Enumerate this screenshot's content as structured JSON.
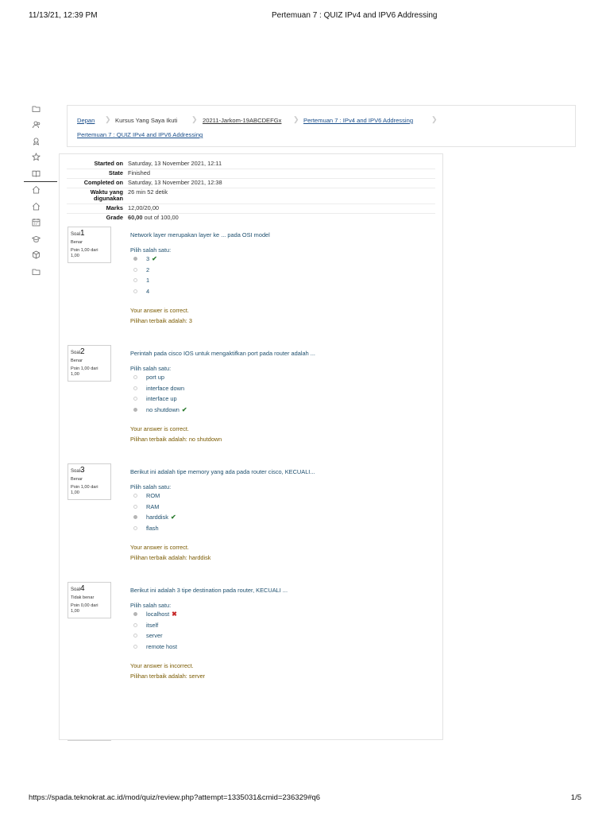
{
  "print": {
    "datetime": "11/13/21, 12:39 PM",
    "title": "Pertemuan 7 : QUIZ IPv4 and IPV6 Addressing",
    "url": "https://spada.teknokrat.ac.id/mod/quiz/review.php?attempt=1335031&cmid=236329#q6",
    "page": "1/5"
  },
  "rail_icons": [
    "folder-icon",
    "users-icon",
    "badge-icon",
    "star-icon",
    "book-icon",
    "home-icon",
    "home-icon",
    "calendar-icon",
    "graduation-cap-icon",
    "cube-icon",
    "folder-icon"
  ],
  "breadcrumb": [
    {
      "label": "Depan"
    },
    {
      "label": "Kursus Yang Saya Ikuti"
    },
    {
      "label": "20211-Jarkom-19ABCDEFGx"
    },
    {
      "label": "Pertemuan 7 : IPv4 and IPV6 Addressing"
    },
    {
      "label": "Pertemuan 7 : QUIZ IPv4 and IPV6 Addressing"
    }
  ],
  "summary": {
    "started_label": "Started on",
    "started_value": "Saturday, 13 November 2021, 12:11",
    "state_label": "State",
    "state_value": "Finished",
    "completed_label": "Completed on",
    "completed_value": "Saturday, 13 November 2021, 12:38",
    "time_label_1": "Waktu yang",
    "time_label_2": "digunakan",
    "time_value": "26 min 52 detik",
    "marks_label": "Marks",
    "marks_value": "12,00/20,00",
    "grade_label": "Grade",
    "grade_value_bold": "60,00",
    "grade_value_rest": " out of 100,00"
  },
  "questions": [
    {
      "soal": "Soal",
      "number": "1",
      "status": "Benar",
      "mark_line1": "Poin 1,00 dari",
      "mark_line2": "1,00",
      "text": "Network layer merupakan layer ke ... pada OSI model",
      "prompt": "Pilih salah satu:",
      "options": [
        "3",
        "2",
        "1",
        "4"
      ],
      "selected": 0,
      "result": "correct",
      "feedback": "Your answer is correct.",
      "right_answer": "Pilihan terbaik adalah: 3"
    },
    {
      "soal": "Soal",
      "number": "2",
      "status": "Benar",
      "mark_line1": "Poin 1,00 dari",
      "mark_line2": "1,00",
      "text": "Perintah pada cisco IOS untuk mengaktifkan port pada router adalah ...",
      "prompt": "Pilih salah satu:",
      "options": [
        "port up",
        "interface down",
        "interface up",
        "no shutdown"
      ],
      "selected": 3,
      "result": "correct",
      "feedback": "Your answer is correct.",
      "right_answer": "Pilihan terbaik adalah: no shutdown"
    },
    {
      "soal": "Soal",
      "number": "3",
      "status": "Benar",
      "mark_line1": "Poin 1,00 dari",
      "mark_line2": "1,00",
      "text": "Berikut ini adalah tipe memory yang ada pada router cisco, KECUALI...",
      "prompt": "Pilih salah satu:",
      "options": [
        "ROM",
        "RAM",
        "harddisk",
        "flash"
      ],
      "selected": 2,
      "result": "correct",
      "feedback": "Your answer is correct.",
      "right_answer": "Pilihan terbaik adalah: harddisk"
    },
    {
      "soal": "Soal",
      "number": "4",
      "status": "Tidak benar",
      "mark_line1": "Poin 0,00 dari",
      "mark_line2": "1,00",
      "text": "Berikut ini adalah 3 tipe destination pada router, KECUALI ...",
      "prompt": "Pilih salah satu:",
      "options": [
        "localhost",
        "itself",
        "server",
        "remote host"
      ],
      "selected": 0,
      "result": "incorrect",
      "feedback": "Your answer is incorrect.",
      "right_answer": "Pilihan terbaik adalah: server"
    }
  ],
  "colors": {
    "link": "#1a4e8a",
    "question_text": "#1e4f6e",
    "feedback": "#7a5a00",
    "correct": "#2e7d32",
    "incorrect": "#c62828"
  }
}
